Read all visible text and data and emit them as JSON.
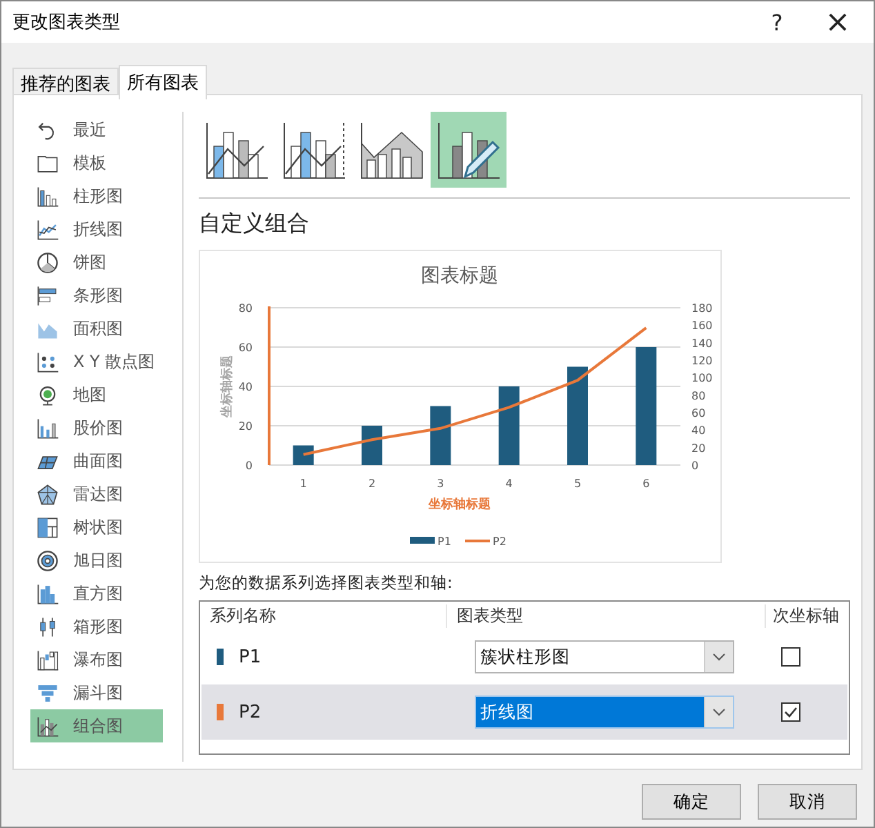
{
  "window": {
    "title": "更改图表类型",
    "help": "?",
    "close": "×"
  },
  "tabs": [
    {
      "label": "推荐的图表",
      "selected": false
    },
    {
      "label": "所有图表",
      "selected": true
    }
  ],
  "sidebar": {
    "items": [
      {
        "label": "最近",
        "selected": false
      },
      {
        "label": "模板",
        "selected": false
      },
      {
        "label": "柱形图",
        "selected": false
      },
      {
        "label": "折线图",
        "selected": false
      },
      {
        "label": "饼图",
        "selected": false
      },
      {
        "label": "条形图",
        "selected": false
      },
      {
        "label": "面积图",
        "selected": false
      },
      {
        "label": "X Y 散点图",
        "selected": false
      },
      {
        "label": "地图",
        "selected": false
      },
      {
        "label": "股价图",
        "selected": false
      },
      {
        "label": "曲面图",
        "selected": false
      },
      {
        "label": "雷达图",
        "selected": false
      },
      {
        "label": "树状图",
        "selected": false
      },
      {
        "label": "旭日图",
        "selected": false
      },
      {
        "label": "直方图",
        "selected": false
      },
      {
        "label": "箱形图",
        "selected": false
      },
      {
        "label": "瀑布图",
        "selected": false
      },
      {
        "label": "漏斗图",
        "selected": false
      },
      {
        "label": "组合图",
        "selected": true
      }
    ]
  },
  "subtypes": [
    {
      "selected": false
    },
    {
      "selected": false
    },
    {
      "selected": false
    },
    {
      "selected": true
    }
  ],
  "section_title": "自定义组合",
  "preview": {
    "chart_data": {
      "type": "bar",
      "title": "图表标题",
      "xlabel": "坐标轴标题",
      "ylabel": "坐标轴标题",
      "categories": [
        "1",
        "2",
        "3",
        "4",
        "5",
        "6"
      ],
      "series": [
        {
          "name": "P1",
          "type": "bar",
          "color": "#1f5c7f",
          "values": [
            10,
            20,
            30,
            40,
            50,
            60
          ]
        },
        {
          "name": "P2",
          "type": "line",
          "axis": "y2",
          "color": "#e8783a",
          "values": [
            12,
            29,
            42,
            66,
            97,
            157
          ]
        }
      ],
      "grid": true,
      "legend": "bottom",
      "ylim": [
        0,
        80
      ],
      "yticks": [
        0,
        20,
        40,
        60,
        80
      ],
      "y2lim": [
        0,
        180
      ],
      "y2ticks": [
        0,
        20,
        40,
        60,
        80,
        100,
        120,
        140,
        160,
        180
      ]
    }
  },
  "series_prompt": "为您的数据系列选择图表类型和轴:",
  "series_table": {
    "columns": [
      "系列名称",
      "图表类型",
      "次坐标轴"
    ],
    "rows": [
      {
        "name": "P1",
        "color": "#1f5c7f",
        "chart_type": "簇状柱形图",
        "secondary_axis": false,
        "selected": false
      },
      {
        "name": "P2",
        "color": "#e8783a",
        "chart_type": "折线图",
        "secondary_axis": true,
        "selected": true
      }
    ]
  },
  "buttons": [
    "确定",
    "取消"
  ]
}
